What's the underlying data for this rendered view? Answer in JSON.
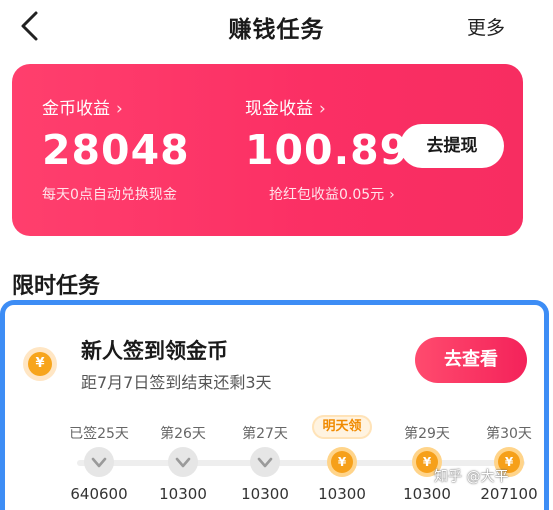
{
  "header": {
    "title": "赚钱任务",
    "more_label": "更多"
  },
  "earnings": {
    "coins_label": "金币收益",
    "coins_value": "28048",
    "coins_note": "每天0点自动兑换现金",
    "cash_label": "现金收益",
    "cash_value": "100.89",
    "cash_note": "抢红包收益0.05元",
    "withdraw_label": "去提现"
  },
  "section_title": "限时任务",
  "task": {
    "title": "新人签到领金币",
    "subtitle": "距7月7日签到结束还剩3天",
    "button_label": "去查看",
    "coin_symbol": "¥",
    "days": [
      {
        "label": "已签25天",
        "amount": "640600",
        "state": "done"
      },
      {
        "label": "第26天",
        "amount": "10300",
        "state": "done"
      },
      {
        "label": "第27天",
        "amount": "10300",
        "state": "done"
      },
      {
        "label": "明天领",
        "amount": "10300",
        "state": "tomorrow"
      },
      {
        "label": "第29天",
        "amount": "10300",
        "state": "coin"
      },
      {
        "label": "第30天",
        "amount": "207100",
        "state": "coin"
      }
    ]
  },
  "watermark": "知乎 @大平",
  "colors": {
    "card_pink": "#fb2f64",
    "task_border": "#3d8df5",
    "coin": "#f6a01a"
  }
}
